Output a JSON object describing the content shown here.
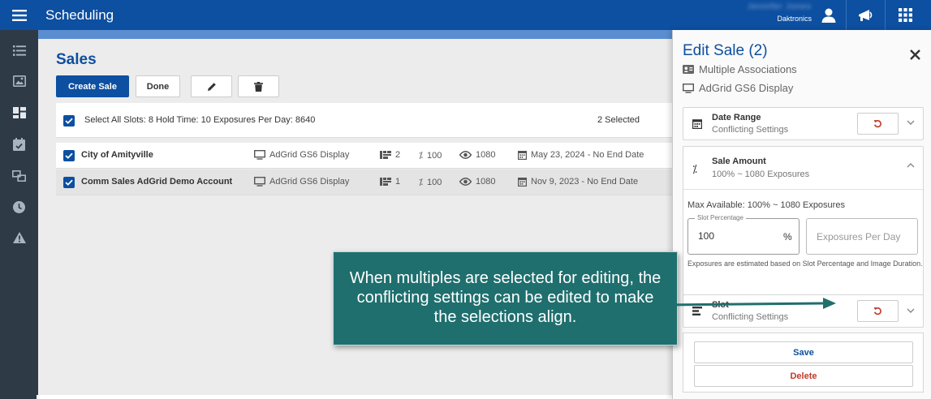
{
  "app": {
    "title": "Scheduling"
  },
  "header": {
    "user_name": "Jennifer Jones",
    "org": "Daktronics"
  },
  "sidebar": {
    "items": [
      {
        "icon": "list-icon"
      },
      {
        "icon": "image-icon"
      },
      {
        "icon": "dashboard-icon"
      },
      {
        "icon": "calendar-check-icon"
      },
      {
        "icon": "transfer-icon"
      },
      {
        "icon": "clock-icon"
      },
      {
        "icon": "warning-icon"
      }
    ]
  },
  "sales": {
    "title": "Sales",
    "create_label": "Create Sale",
    "done_label": "Done",
    "select_all": {
      "summary": "Select All  Slots: 8  Hold Time: 10  Exposures Per Day: 8640",
      "selected_count": "2 Selected"
    },
    "rows": [
      {
        "name": "City of Amityville",
        "display": "AdGrid GS6 Display",
        "slots": "2",
        "percent": "100",
        "views": "1080",
        "dates": "May 23, 2024 - No End Date"
      },
      {
        "name": "Comm Sales AdGrid Demo Account",
        "display": "AdGrid GS6 Display",
        "slots": "1",
        "percent": "100",
        "views": "1080",
        "dates": "Nov 9, 2023 - No End Date"
      }
    ]
  },
  "panel": {
    "title": "Edit Sale (2)",
    "associations": "Multiple Associations",
    "display": "AdGrid GS6 Display",
    "date_range": {
      "title": "Date Range",
      "status": "Conflicting Settings"
    },
    "sale_amount": {
      "title": "Sale Amount",
      "summary": "100% ~ 1080 Exposures",
      "max_available": "Max Available: 100% ~ 1080 Exposures",
      "slot_label": "Slot Percentage",
      "slot_value": "100",
      "slot_unit": "%",
      "exposures_placeholder": "Exposures Per Day",
      "note": "Exposures are estimated based on Slot Percentage and Image Duration."
    },
    "slot": {
      "title": "Slot",
      "status": "Conflicting Settings"
    },
    "save_label": "Save",
    "delete_label": "Delete"
  },
  "callout": {
    "text": "When multiples are selected for editing, the conflicting settings can be edited to make the selections align."
  },
  "colors": {
    "primary": "#0d4fa0",
    "sidebar": "#2f3a47",
    "callout": "#1f6f6e",
    "danger": "#c0392b"
  }
}
